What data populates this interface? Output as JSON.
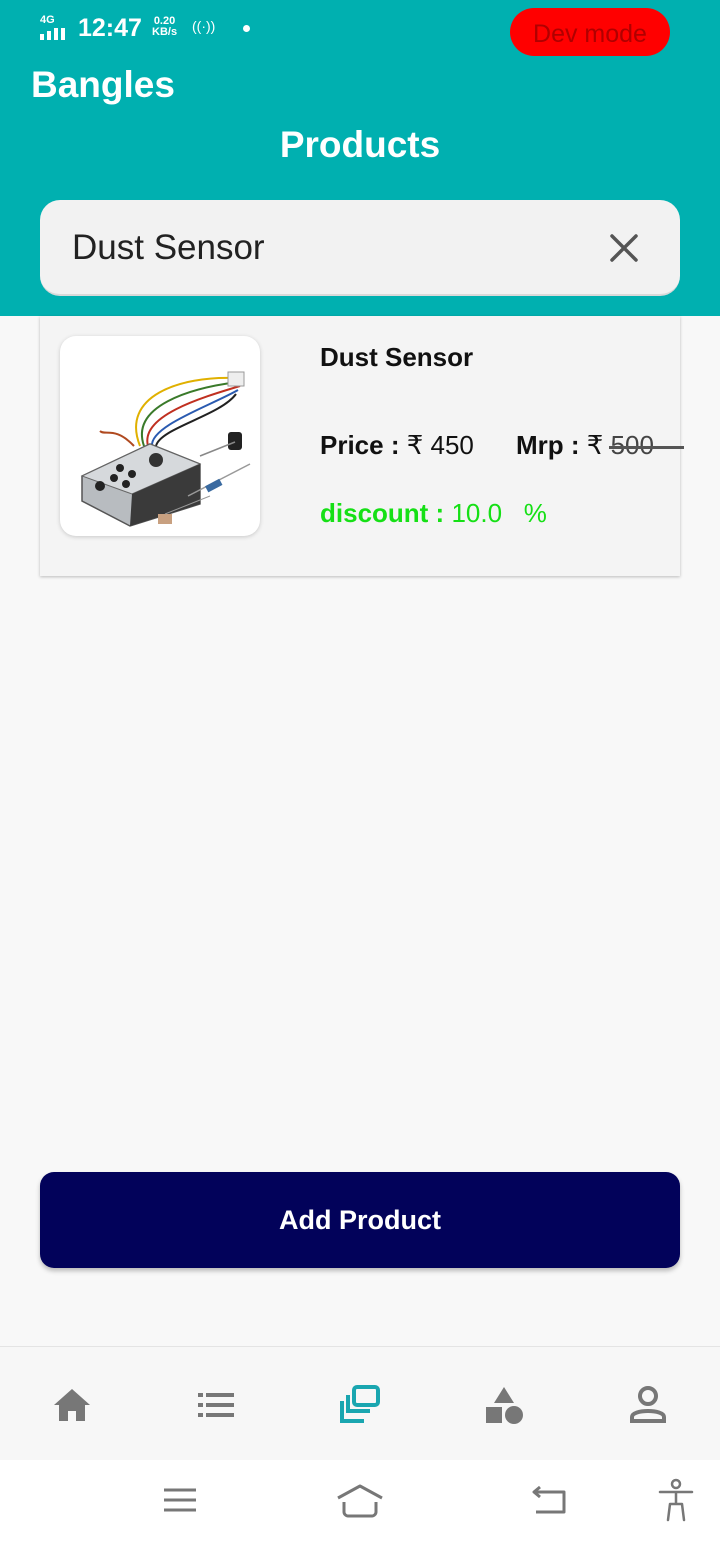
{
  "status_bar": {
    "network": "4G",
    "time": "12:47",
    "speed_value": "0.20",
    "speed_unit": "KB/s",
    "dev_mode_label": "Dev mode"
  },
  "header": {
    "app_name": "Bangles",
    "page_title": "Products"
  },
  "search": {
    "value": "Dust Sensor",
    "clear_icon": "close-icon"
  },
  "products": [
    {
      "name": "Dust Sensor",
      "price_label": "Price :",
      "price_value": "₹ 450",
      "mrp_label": "Mrp :",
      "mrp_currency": "₹",
      "mrp_value": "500",
      "discount_label": "discount :",
      "discount_value": "10.0",
      "discount_unit": "%"
    }
  ],
  "actions": {
    "add_product_label": "Add Product"
  },
  "bottom_nav": [
    {
      "icon": "home-icon",
      "active": false
    },
    {
      "icon": "list-icon",
      "active": false
    },
    {
      "icon": "products-icon",
      "active": true
    },
    {
      "icon": "categories-icon",
      "active": false
    },
    {
      "icon": "profile-icon",
      "active": false
    }
  ],
  "colors": {
    "brand": "#00b0b0",
    "primary_button": "#02025a",
    "dev_badge": "#ff0000",
    "discount": "#16e016",
    "nav_inactive": "#777777"
  }
}
